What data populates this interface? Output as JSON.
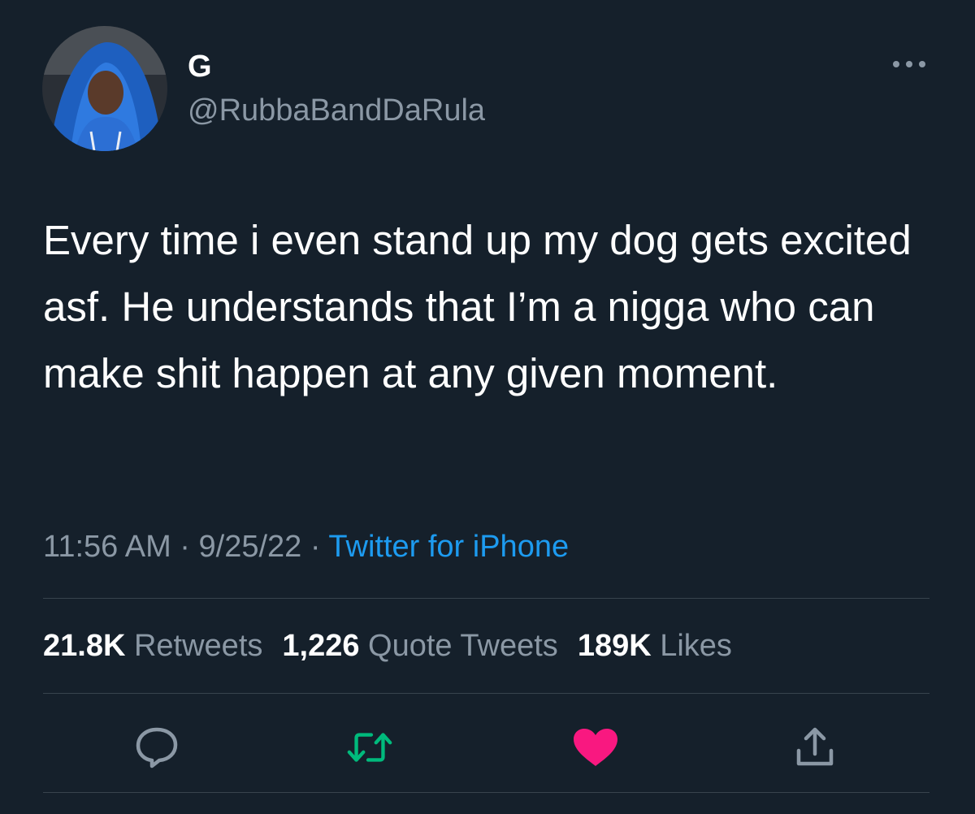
{
  "user": {
    "display_name": "G",
    "handle": "@RubbaBandDaRula"
  },
  "tweet": {
    "text": "Every time i even stand up my dog gets excited asf. He understands that I’m a nigga who can make shit happen at any given moment."
  },
  "meta": {
    "time": "11:56 AM",
    "separator": " · ",
    "date": "9/25/22",
    "source": "Twitter for iPhone"
  },
  "stats": {
    "retweets_count": "21.8K",
    "retweets_label": "Retweets",
    "quotes_count": "1,226",
    "quotes_label": "Quote Tweets",
    "likes_count": "189K",
    "likes_label": "Likes"
  },
  "icons": {
    "more": "more-horizontal-icon",
    "reply": "reply-icon",
    "retweet": "retweet-icon",
    "like": "heart-icon",
    "share": "share-icon"
  },
  "colors": {
    "background": "#15202b",
    "secondary_text": "#8b98a5",
    "link": "#1d9bf0",
    "retweet_active": "#00ba7c",
    "like_active": "#f91880",
    "divider": "#38444d"
  }
}
